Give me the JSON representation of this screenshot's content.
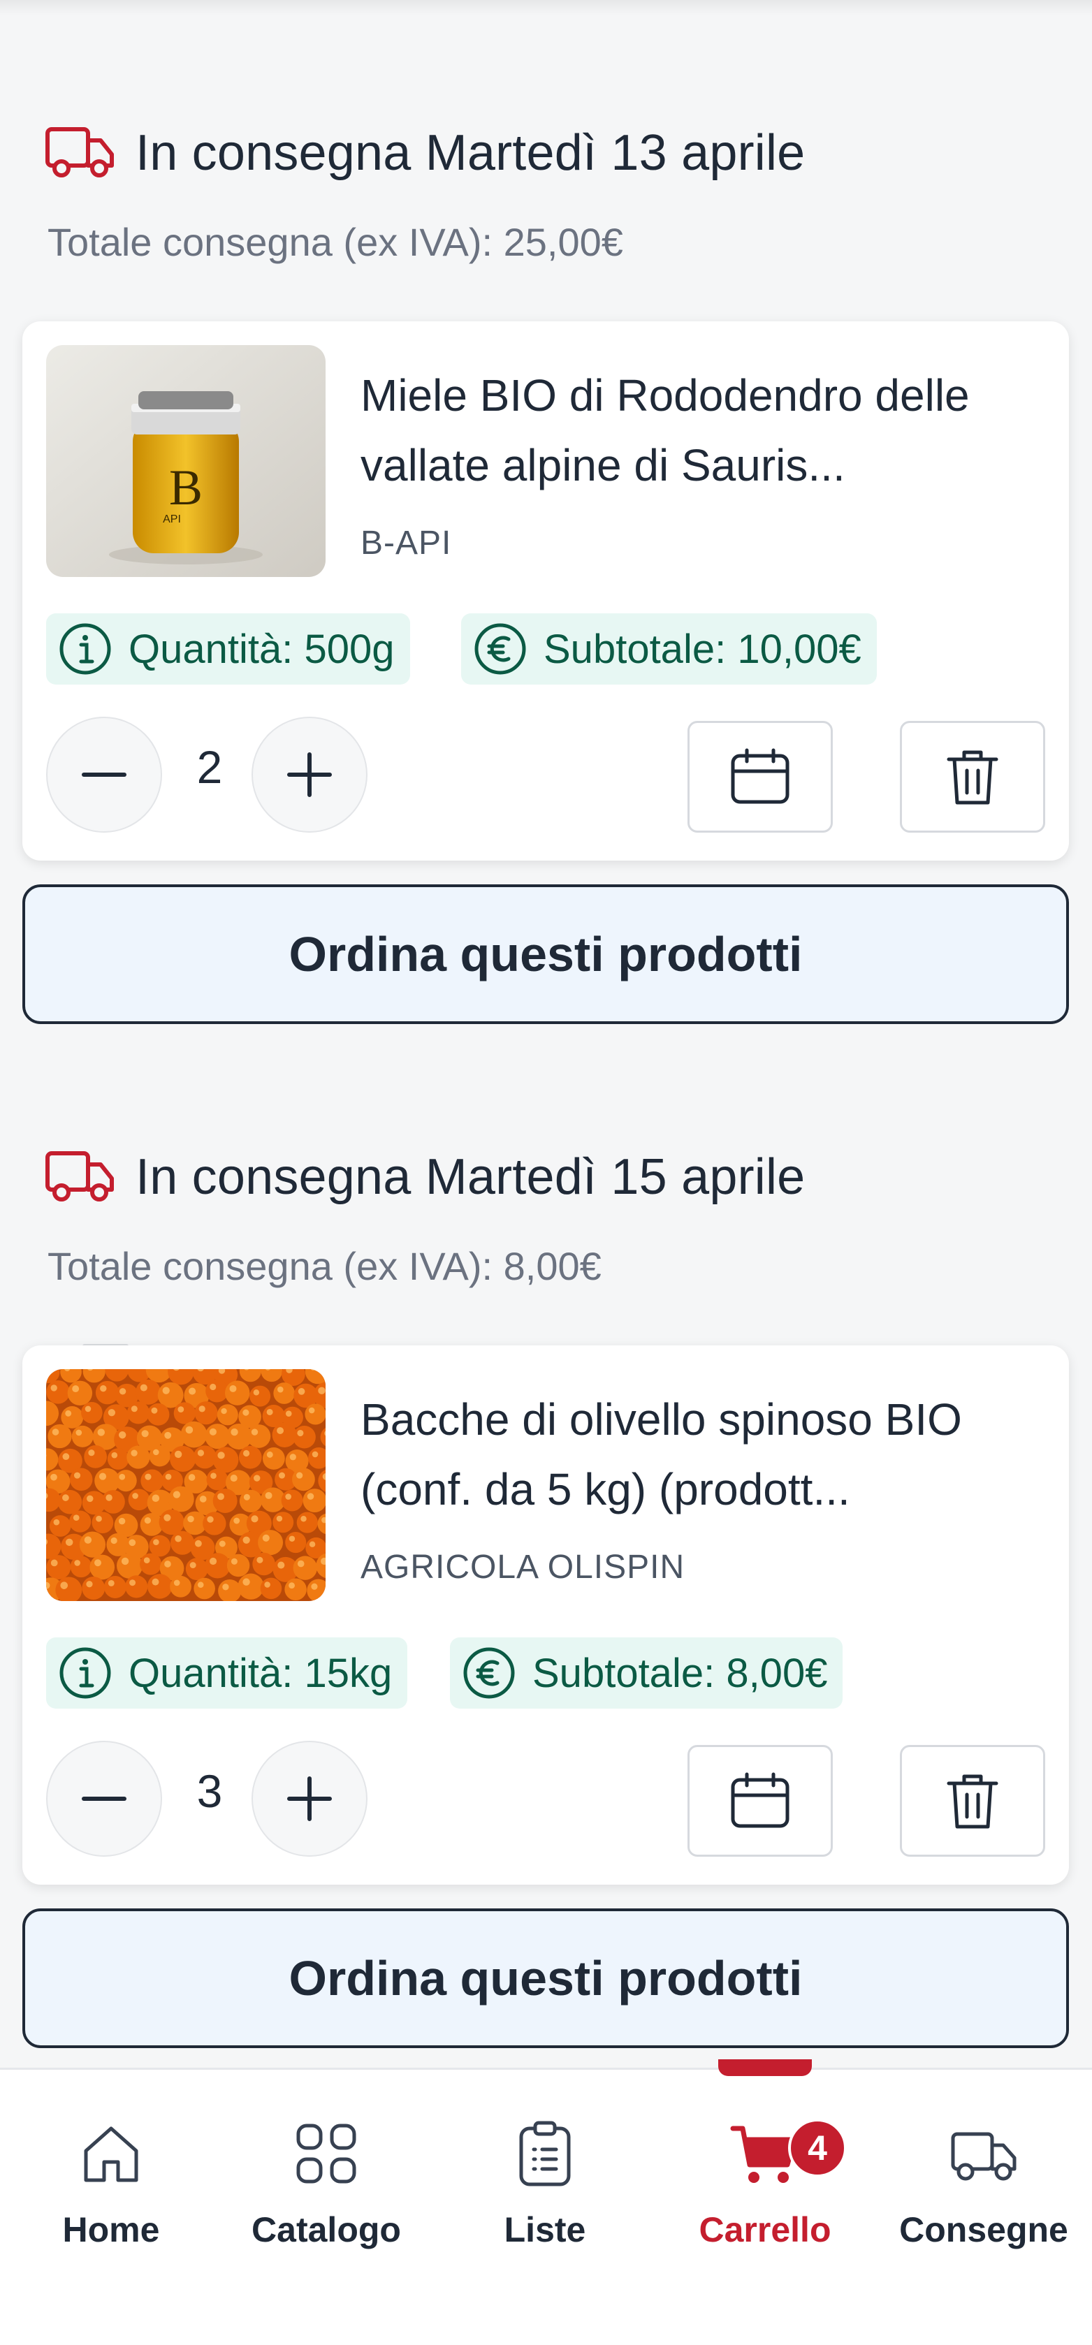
{
  "deliveries": [
    {
      "title": "In consegna Martedì 13 aprile",
      "total": "Totale consegna (ex IVA): 25,00€",
      "product": {
        "name": "Miele BIO di Rododendro delle vallate alpine di Sauris...",
        "brand": "B-API",
        "quantity_chip": "Quantità: 500g",
        "subtotal_chip": "Subtotale: 10,00€",
        "qty": "2",
        "jar_letter": "B",
        "jar_small": "API"
      },
      "order_label": "Ordina questi prodotti"
    },
    {
      "title": "In consegna Martedì 15 aprile",
      "total": "Totale consegna (ex IVA): 8,00€",
      "product": {
        "name": "Bacche di olivello spinoso BIO (conf. da 5 kg) (prodott...",
        "brand": "AGRICOLA OLISPIN",
        "quantity_chip": "Quantità: 15kg",
        "subtotal_chip": "Subtotale: 8,00€",
        "qty": "3"
      },
      "order_label": "Ordina questi prodotti"
    }
  ],
  "nav": {
    "items": [
      {
        "label": "Home",
        "icon": "home-icon"
      },
      {
        "label": "Catalogo",
        "icon": "grid-icon"
      },
      {
        "label": "Liste",
        "icon": "clipboard-icon"
      },
      {
        "label": "Carrello",
        "icon": "cart-icon",
        "active": true
      },
      {
        "label": "Consegne",
        "icon": "truck-icon"
      }
    ],
    "cart_badge": "4"
  },
  "colors": {
    "accent": "#c41e2e",
    "chip_bg": "#e7f7f3",
    "chip_text": "#0b5a44",
    "order_bg": "#eef5fd"
  }
}
